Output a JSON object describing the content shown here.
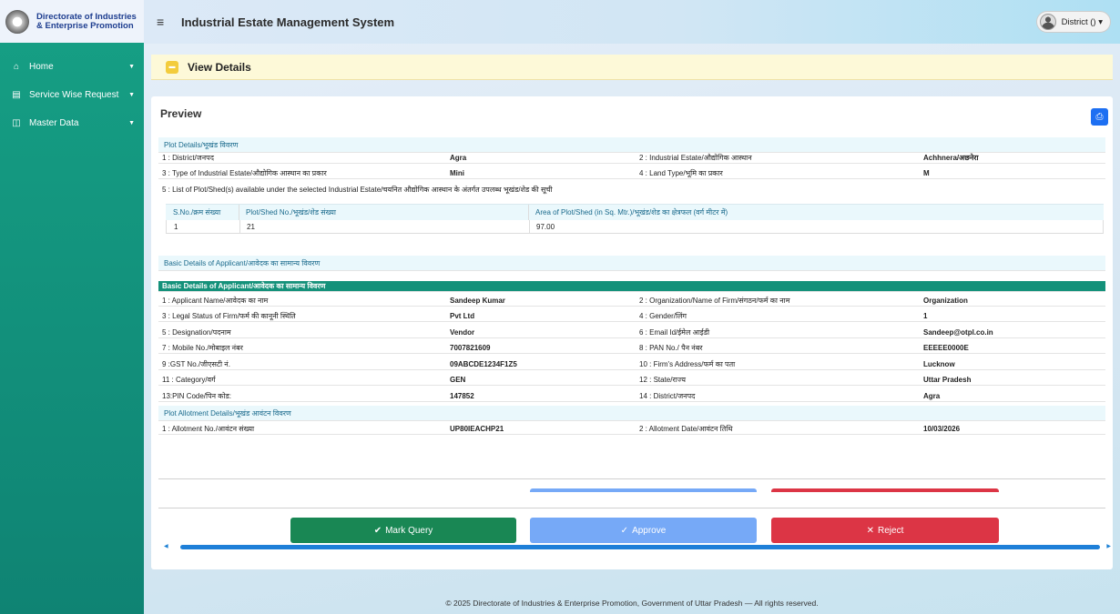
{
  "brand": {
    "line1": "Directorate of Industries",
    "line2": "& Enterprise Promotion"
  },
  "topbar": {
    "title": "Industrial Estate Management System",
    "user": "District () ▾"
  },
  "sidebar": {
    "items": [
      {
        "label": "Home",
        "icon": "home-icon"
      },
      {
        "label": "Service Wise Request",
        "icon": "request-icon"
      },
      {
        "label": "Master Data",
        "icon": "data-icon"
      }
    ]
  },
  "page": {
    "title": "View Details",
    "preview": "Preview"
  },
  "plot": {
    "section": "Plot Details/भूखंड विवरण",
    "rows": [
      {
        "l1": "1 : District/जनपद",
        "v1": "Agra",
        "l2": "2 : Industrial Estate/औद्योगिक आस्थान",
        "v2": "Achhnera/अछनेरा"
      },
      {
        "l1": "3 : Type of Industrial Estate/औद्योगिक आस्थान का प्रकार",
        "v1": "Mini",
        "l2": "4 : Land Type/भूमि का प्रकार",
        "v2": "M"
      }
    ],
    "list_label": "5 : List of Plot/Shed(s) available under the selected Industrial Estate/चयनित औद्योगिक आस्थान के अंतर्गत उपलब्ध भूखंड/शेड की सूची",
    "table": {
      "headers": [
        "S.No./क्रम संख्या",
        "Plot/Shed No./भूखंड/शेड संख्या",
        "Area of Plot/Shed (in Sq. Mtr.)/भूखंड/शेड का क्षेत्रफल (वर्ग मीटर में)"
      ],
      "row": [
        "1",
        "21",
        "97.00"
      ]
    }
  },
  "applicant": {
    "section": "Basic Details of Applicant/आवेदक का सामान्य विवरण",
    "header": "Basic Details of Applicant/आवेदक का सामान्य विवरण",
    "rows": [
      {
        "l1": "1 : Applicant Name/आवेदक का नाम",
        "v1": "Sandeep Kumar",
        "l2": "2 : Organization/Name of Firm/संगठन/फर्म का नाम",
        "v2": "Organization"
      },
      {
        "l1": "3 : Legal Status of Firm/फर्म की कानूनी स्थिति",
        "v1": "Pvt Ltd",
        "l2": "4 : Gender/लिंग",
        "v2": "1"
      },
      {
        "l1": "5 : Designation/पदनाम",
        "v1": "Vendor",
        "l2": "6 : Email Id/ईमेल आईडी",
        "v2": "Sandeep@otpl.co.in"
      },
      {
        "l1": "7 : Mobile No./मोबाइल नंबर",
        "v1": "7007821609",
        "l2": "8 : PAN No./ पैन नंबर",
        "v2": "EEEEE0000E"
      },
      {
        "l1": "9 :GST No./जीएसटी नं.",
        "v1": "09ABCDE1234F1Z5",
        "l2": "10 : Firm's Address/फर्म का पता",
        "v2": "Lucknow"
      },
      {
        "l1": "11 : Category/वर्ग",
        "v1": "GEN",
        "l2": "12 : State/राज्य",
        "v2": "Uttar Pradesh"
      },
      {
        "l1": "13:PIN Code/पिन कोड:",
        "v1": "147852",
        "l2": "14 : District/जनपद",
        "v2": "Agra"
      }
    ]
  },
  "allotment": {
    "section": "Plot Allotment Details/भूखंड आवंटन विवरण",
    "row": {
      "l1": "1 : Allotment No./आवंटन संख्या",
      "v1": "UP80IEACHP21",
      "l2": "2 : Allotment Date/आवंटन तिथि",
      "v2": "10/03/2026"
    }
  },
  "actions": {
    "query": "Mark Query",
    "approve": "Approve",
    "reject": "Reject"
  },
  "colors": {
    "sidebar": "#16a085",
    "query": "#198754",
    "approve": "#76a9f7",
    "reject": "#dc3545",
    "primary": "#1d6ff2"
  },
  "footer": "© 2025 Directorate of Industries & Enterprise Promotion, Government of Uttar Pradesh — All rights reserved."
}
